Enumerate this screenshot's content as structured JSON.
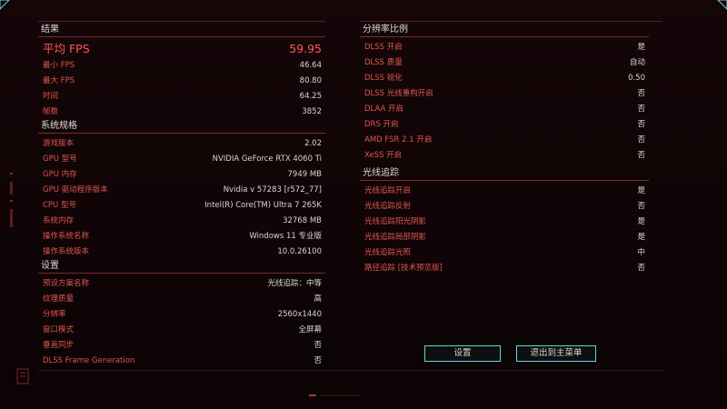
{
  "left": {
    "results": {
      "header": "结果",
      "rows": [
        {
          "label": "平均 FPS",
          "value": "59.95",
          "big": true
        },
        {
          "label": "最小 FPS",
          "value": "46.64"
        },
        {
          "label": "最大 FPS",
          "value": "80.80"
        },
        {
          "label": "时间",
          "value": "64.25"
        },
        {
          "label": "帧数",
          "value": "3852"
        }
      ]
    },
    "system": {
      "header": "系统规格",
      "rows": [
        {
          "label": "游戏版本",
          "value": "2.02"
        },
        {
          "label": "GPU 型号",
          "value": "NVIDIA GeForce RTX 4060 Ti"
        },
        {
          "label": "GPU 内存",
          "value": "7949 MB"
        },
        {
          "label": "GPU 驱动程序版本",
          "value": "Nvidia v 57283 [r572_77]"
        },
        {
          "label": "CPU 型号",
          "value": "Intel(R) Core(TM) Ultra 7 265K"
        },
        {
          "label": "系统内存",
          "value": "32768 MB"
        },
        {
          "label": "操作系统名称",
          "value": "Windows 11 专业版"
        },
        {
          "label": "操作系统版本",
          "value": "10.0.26100"
        }
      ]
    },
    "settings": {
      "header": "设置",
      "rows": [
        {
          "label": "预设方案名称",
          "value": "光线追踪：中等"
        },
        {
          "label": "纹理质量",
          "value": "高"
        },
        {
          "label": "分辨率",
          "value": "2560x1440"
        },
        {
          "label": "窗口模式",
          "value": "全屏幕"
        },
        {
          "label": "垂直同步",
          "value": "否"
        },
        {
          "label": "DLSS Frame Generation",
          "value": "否"
        }
      ]
    }
  },
  "right": {
    "resolution": {
      "header": "分辨率比例",
      "rows": [
        {
          "label": "DLSS 开启",
          "value": "是"
        },
        {
          "label": "DLSS 质量",
          "value": "自动"
        },
        {
          "label": "DLSS 锐化",
          "value": "0.50"
        },
        {
          "label": "DLSS 光线重构开启",
          "value": "否"
        },
        {
          "label": "DLAA 开启",
          "value": "否"
        },
        {
          "label": "DRS 开启",
          "value": "否"
        },
        {
          "label": "AMD FSR 2.1 开启",
          "value": "否"
        },
        {
          "label": "XeSS 开启",
          "value": "否"
        }
      ]
    },
    "raytracing": {
      "header": "光线追踪",
      "rows": [
        {
          "label": "光线追踪开启",
          "value": "是"
        },
        {
          "label": "光线追踪反射",
          "value": "否"
        },
        {
          "label": "光线追踪阳光阴影",
          "value": "是"
        },
        {
          "label": "光线追踪局部阴影",
          "value": "是"
        },
        {
          "label": "光线追踪光照",
          "value": "中"
        },
        {
          "label": "路径追踪 [技术预览版]",
          "value": "否"
        }
      ]
    }
  },
  "buttons": {
    "settings": "设置",
    "exit": "退出到主菜单"
  },
  "colors": {
    "accent_red": "#e0564f",
    "accent_cyan": "#5fd6d6",
    "value_text": "#d8d8d8"
  }
}
